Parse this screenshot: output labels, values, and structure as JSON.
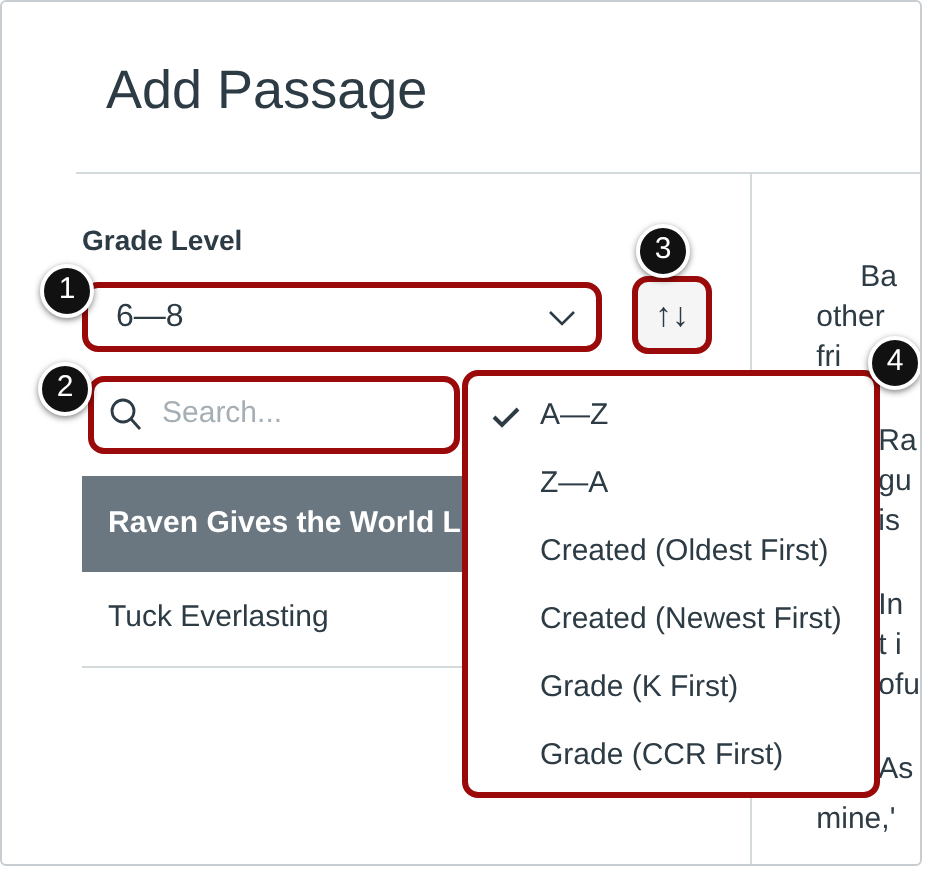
{
  "title": "Add Passage",
  "grade_level": {
    "label": "Grade Level",
    "value": "6—8"
  },
  "sort_button": {
    "icon": "↑↓"
  },
  "search": {
    "placeholder": "Search..."
  },
  "passages": [
    {
      "title": "Raven Gives the World L",
      "selected": true
    },
    {
      "title": "Tuck Everlasting",
      "selected": false
    }
  ],
  "sort_menu": {
    "items": [
      {
        "label": "A—Z",
        "selected": true
      },
      {
        "label": "Z—A",
        "selected": false
      },
      {
        "label": "Created (Oldest First)",
        "selected": false
      },
      {
        "label": "Created (Newest First)",
        "selected": false
      },
      {
        "label": "Grade (K First)",
        "selected": false
      },
      {
        "label": "Grade (CCR First)",
        "selected": false
      }
    ]
  },
  "preview": {
    "paragraphs": [
      [
        "Ba",
        "other",
        "fri"
      ],
      [
        "Ra",
        "gu",
        "is"
      ],
      [
        "In",
        "t i",
        "ofu"
      ],
      [
        "As",
        "mine,'"
      ]
    ]
  },
  "callouts": [
    "1",
    "2",
    "3",
    "4"
  ]
}
